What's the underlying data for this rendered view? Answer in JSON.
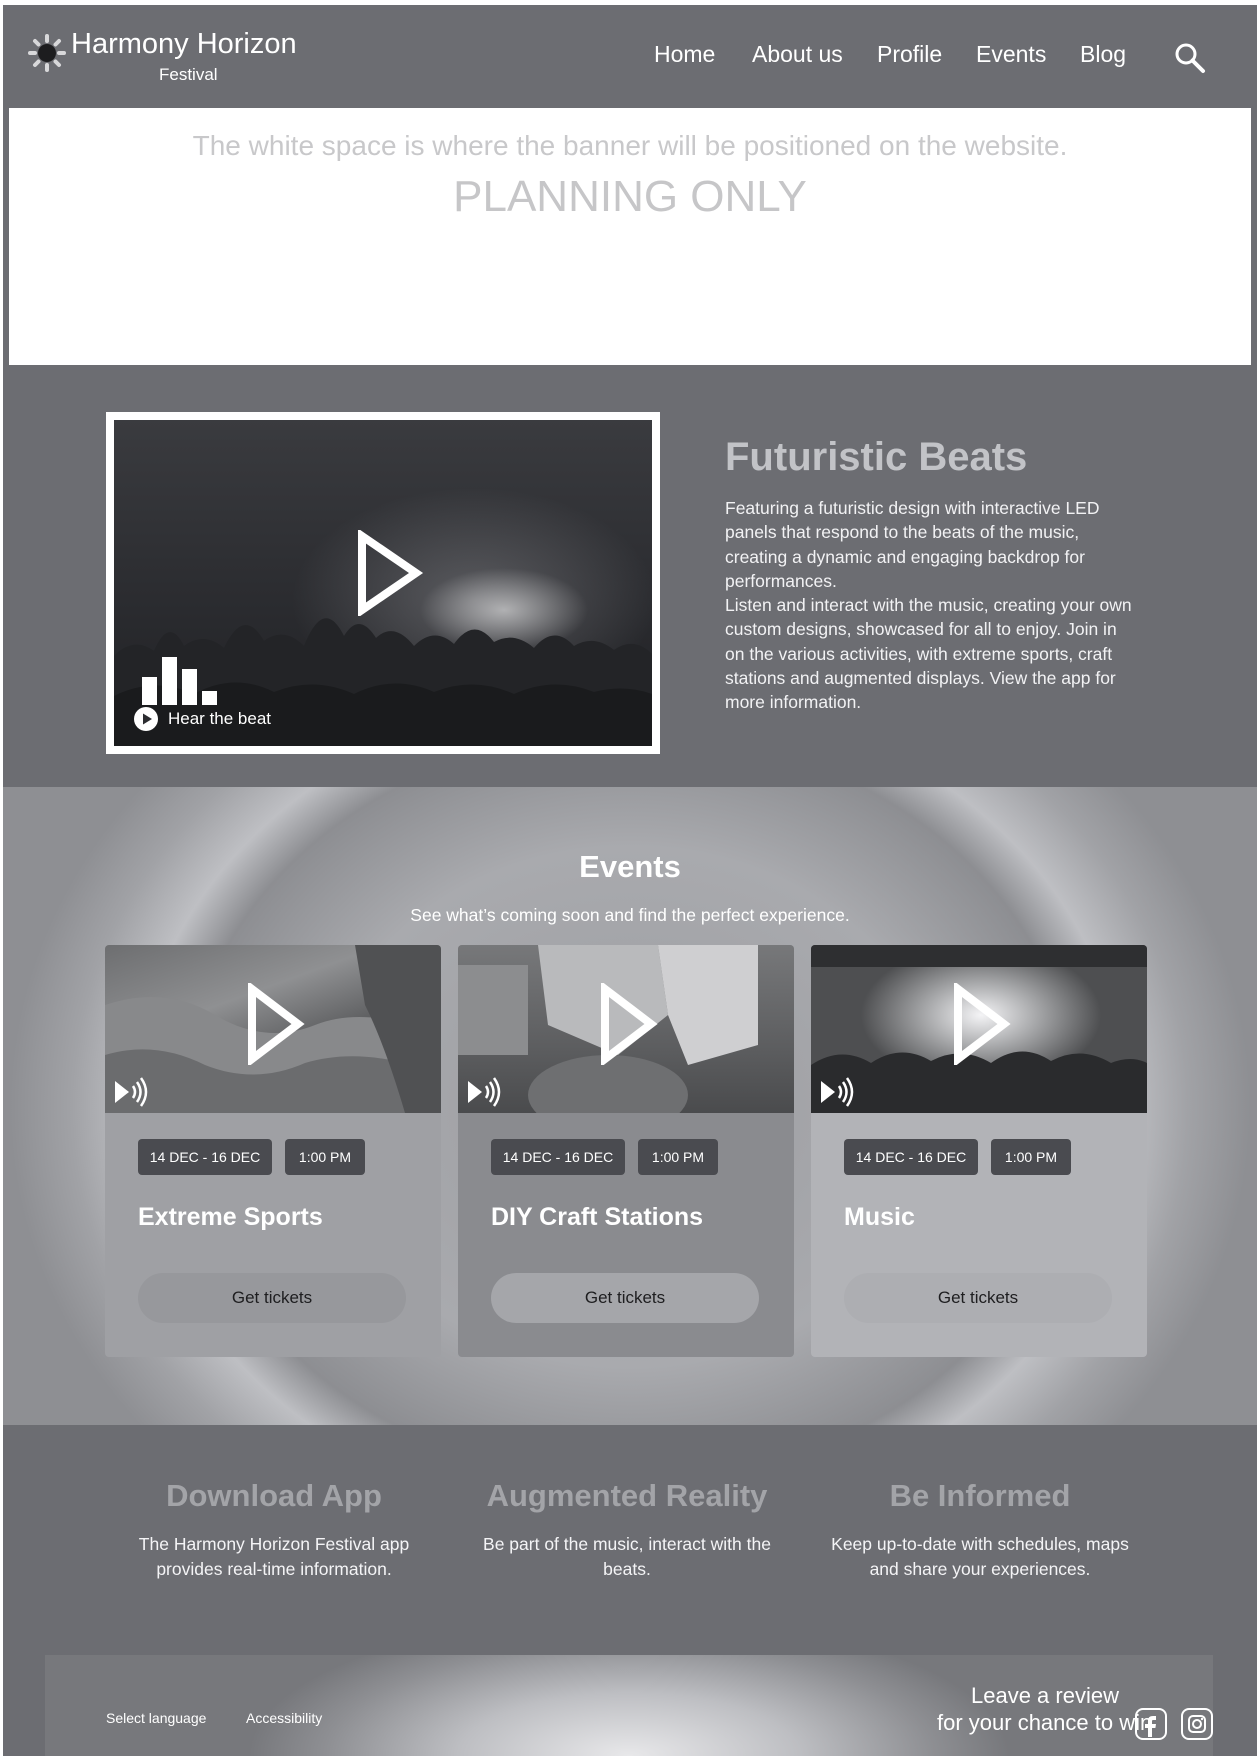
{
  "header": {
    "brand_name": "Harmony Horizon",
    "brand_sub": "Festival",
    "nav": [
      "Home",
      "About us",
      "Profile",
      "Events",
      "Blog"
    ],
    "search_icon": "search-icon"
  },
  "banner": {
    "note": "The white space is where the banner will be positioned on the website.",
    "planning": "PLANNING ONLY"
  },
  "feature": {
    "title": "Futuristic Beats",
    "paragraph1": "Featuring a futuristic design with interactive LED panels that respond to the beats of the music, creating a dynamic and engaging backdrop for performances.",
    "paragraph2": "Listen and interact with the music, creating your own custom designs, showcased for all to enjoy. Join in on the various activities, with extreme sports, craft stations and augmented displays. View the app for more information.",
    "video_label": "Hear the beat"
  },
  "events": {
    "title": "Events",
    "subtitle": "See what’s coming soon and find the perfect experience.",
    "cards": [
      {
        "date": "14 DEC - 16 DEC",
        "time": "1:00 PM",
        "title": "Extreme Sports",
        "button": "Get tickets"
      },
      {
        "date": "14 DEC - 16 DEC",
        "time": "1:00 PM",
        "title": "DIY Craft Stations",
        "button": "Get tickets"
      },
      {
        "date": "14 DEC - 16 DEC",
        "time": "1:00 PM",
        "title": "Music",
        "button": "Get tickets"
      }
    ]
  },
  "info": [
    {
      "title": "Download App",
      "text": "The Harmony Horizon Festival app provides real-time information."
    },
    {
      "title": "Augmented Reality",
      "text": "Be part of the music, interact with the beats."
    },
    {
      "title": "Be Informed",
      "text": "Keep up-to-date with schedules, maps and share your experiences."
    }
  ],
  "footer": {
    "language": "Select language",
    "accessibility": "Accessibility",
    "review_line1": "Leave a review",
    "review_line2": "for your chance to win"
  },
  "colors": {
    "page_bg": "#6c6d72",
    "chip_bg": "#4a4b50",
    "muted_title": "#c2c3c7"
  }
}
